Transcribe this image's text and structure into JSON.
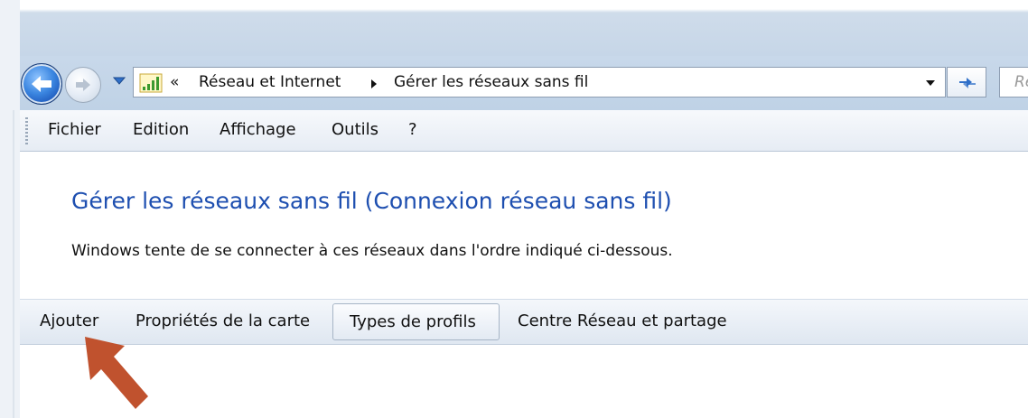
{
  "nav": {
    "breadcrumb_prefix": "«",
    "crumbs": [
      "Réseau et Internet",
      "Gérer les réseaux sans fil"
    ],
    "search_placeholder": "Re"
  },
  "menu": [
    "Fichier",
    "Edition",
    "Affichage",
    "Outils",
    "?"
  ],
  "page": {
    "title": "Gérer les réseaux sans fil (Connexion réseau sans fil)",
    "description": "Windows tente de se connecter à ces réseaux dans l'ordre indiqué ci-dessous."
  },
  "commands": {
    "add": "Ajouter",
    "adapter_props": "Propriétés de la carte",
    "profile_types": "Types de profils",
    "network_center": "Centre Réseau et partage"
  },
  "colors": {
    "title": "#1e4fb0",
    "arrow": "#c0522e"
  },
  "icons": {
    "back": "back-arrow-icon",
    "forward": "forward-arrow-icon",
    "network": "wireless-signal-icon",
    "refresh": "refresh-icon"
  }
}
